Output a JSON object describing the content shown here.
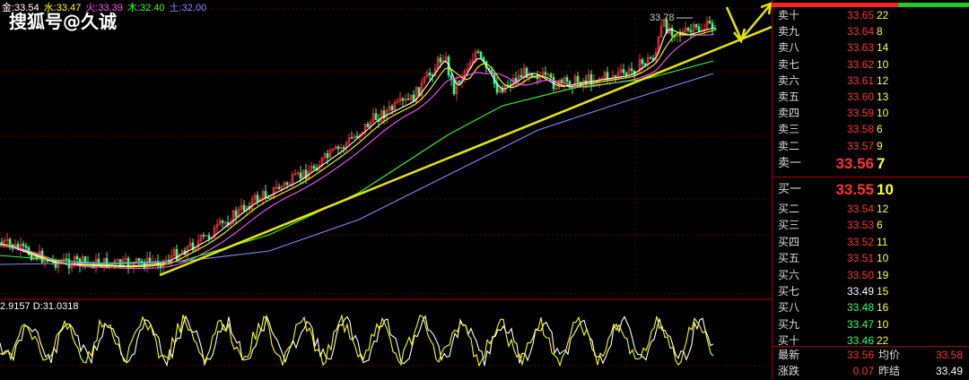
{
  "watermark": "搜狐号@久诚",
  "ma_legend": [
    {
      "label": "金:33.54",
      "color": "#ffffff"
    },
    {
      "label": "水:33.47",
      "color": "#ffff00"
    },
    {
      "label": "火:33.39",
      "color": "#ff55ff"
    },
    {
      "label": "木:32.40",
      "color": "#33ff33"
    },
    {
      "label": "土:32.00",
      "color": "#8888ff"
    }
  ],
  "high_price_label": "33.78",
  "kdj_legend": "2.9157 D:31.0318",
  "colors": {
    "up": "#ff3333",
    "down": "#33ff66",
    "neutral": "#ffffff",
    "volume": "#ffff33",
    "trendline": "#e6e600"
  },
  "order_book": {
    "asks": [
      {
        "label": "卖十",
        "price": "33.65",
        "vol": "22"
      },
      {
        "label": "卖九",
        "price": "33.64",
        "vol": "8"
      },
      {
        "label": "卖八",
        "price": "33.63",
        "vol": "14"
      },
      {
        "label": "卖七",
        "price": "33.62",
        "vol": "10"
      },
      {
        "label": "卖六",
        "price": "33.61",
        "vol": "12"
      },
      {
        "label": "卖五",
        "price": "33.60",
        "vol": "13"
      },
      {
        "label": "卖四",
        "price": "33.59",
        "vol": "10"
      },
      {
        "label": "卖三",
        "price": "33.58",
        "vol": "6"
      },
      {
        "label": "卖二",
        "price": "33.57",
        "vol": "9"
      },
      {
        "label": "卖一",
        "price": "33.56",
        "vol": "7"
      }
    ],
    "bids": [
      {
        "label": "买一",
        "price": "33.55",
        "vol": "10"
      },
      {
        "label": "买二",
        "price": "33.54",
        "vol": "12"
      },
      {
        "label": "买三",
        "price": "33.53",
        "vol": "6"
      },
      {
        "label": "买四",
        "price": "33.52",
        "vol": "11"
      },
      {
        "label": "买五",
        "price": "33.51",
        "vol": "10"
      },
      {
        "label": "买六",
        "price": "33.50",
        "vol": "19"
      },
      {
        "label": "买七",
        "price": "33.49",
        "vol": "15"
      },
      {
        "label": "买八",
        "price": "33.48",
        "vol": "16"
      },
      {
        "label": "买九",
        "price": "33.47",
        "vol": "10"
      },
      {
        "label": "买十",
        "price": "33.46",
        "vol": "22"
      }
    ],
    "footer": {
      "latest_label": "最新",
      "latest": "33.56",
      "avg_label": "均价",
      "avg": "33.58",
      "change_label": "涨跌",
      "change": "0.07",
      "settle_label": "昨结",
      "settle": "33.49"
    }
  }
}
